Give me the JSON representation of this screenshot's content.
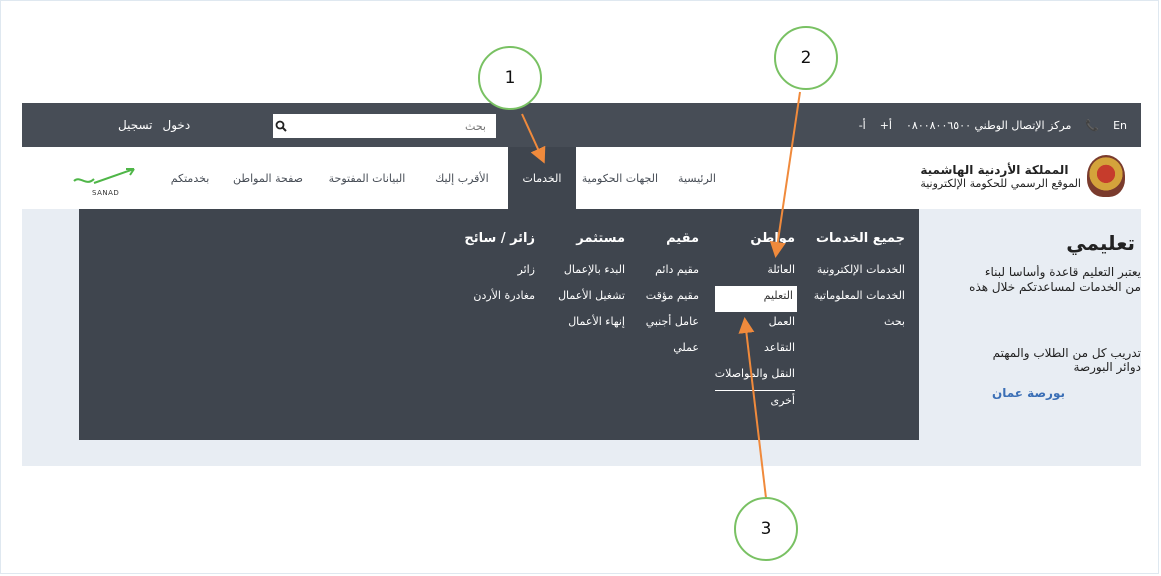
{
  "topbar": {
    "login": "دخول",
    "register": "تسجيل",
    "search_placeholder": "بحث",
    "call_center": "مركز الإتصال الوطني ٠٨٠٠٨٠٠٦٥٠٠",
    "font_increase": "أ+",
    "font_decrease": "أ-",
    "language": "En"
  },
  "brand": {
    "title": "المملكة الأردنية الهاشمية",
    "subtitle": "الموقع الرسمي للحكومة الإلكترونية"
  },
  "nav": {
    "home": "الرئيسية",
    "gov_entities": "الجهات الحكومية",
    "services": "الخدمات",
    "nearest": "الأقرب إليك",
    "open_data": "البيانات المفتوحة",
    "citizen_page": "صفحة المواطن",
    "at_your_service": "بخدمتكم",
    "sanad": "SANAD"
  },
  "mega": {
    "all_services": {
      "header": "جميع الخدمات",
      "items": [
        "الخدمات الإلكترونية",
        "الخدمات المعلوماتية",
        "بحث"
      ]
    },
    "citizen": {
      "header": "مواطن",
      "items": [
        "العائلة",
        "التعليم",
        "العمل",
        "التقاعد",
        "النقل والمواصلات",
        "أخرى"
      ]
    },
    "resident": {
      "header": "مقيم",
      "items": [
        "مقيم دائم",
        "مقيم مؤقت",
        "عامل أجنبي",
        "عملي"
      ]
    },
    "investor": {
      "header": "مستثمر",
      "items": [
        "البدء بالإعمال",
        "تشغيل الأعمال",
        "إنهاء الأعمال"
      ]
    },
    "visitor": {
      "header": "زائر / سائح",
      "items": [
        "زائر",
        "مغادرة الأردن"
      ]
    }
  },
  "page": {
    "title": "تعليمي",
    "desc_line1": "يعتبر التعليم قاعدة وأساسا لبناء",
    "desc_line2": "من الخدمات لمساعدتكم خلال هذه",
    "desc2_line1": "تدريب كل من الطلاب والمهتم",
    "desc2_line2": "دوائر البورصة",
    "link": "بورصة عمان"
  },
  "annotations": {
    "c1": "1",
    "c2": "2",
    "c3": "3"
  },
  "colors": {
    "dark": "#474d56",
    "mega": "#3f454e",
    "arrow": "#f08a3c",
    "circle": "#79c163",
    "link": "#3b6fb6"
  }
}
